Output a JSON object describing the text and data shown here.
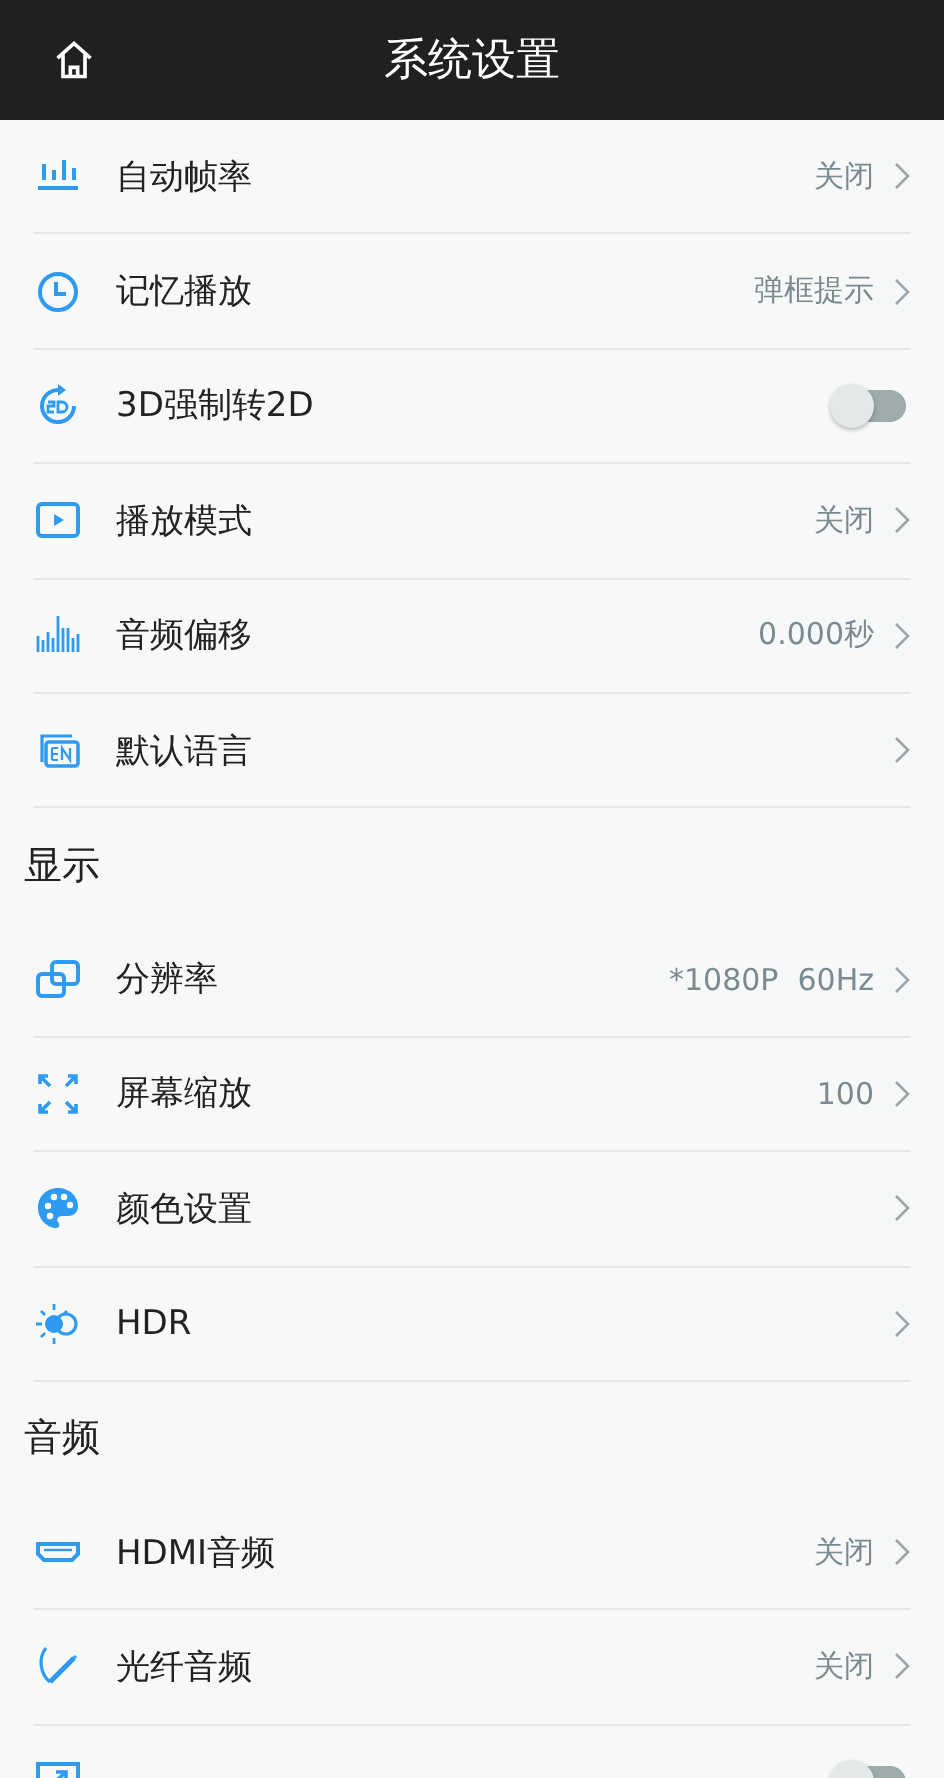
{
  "header": {
    "title": "系统设置"
  },
  "sections": [
    {
      "items": [
        {
          "kind": "value",
          "label": "自动帧率",
          "value": "关闭"
        },
        {
          "kind": "value",
          "label": "记忆播放",
          "value": "弹框提示"
        },
        {
          "kind": "switch",
          "label": "3D强制转2D",
          "on": false
        },
        {
          "kind": "value",
          "label": "播放模式",
          "value": "关闭"
        },
        {
          "kind": "value",
          "label": "音频偏移",
          "value": "0.000秒"
        },
        {
          "kind": "value",
          "label": "默认语言"
        }
      ]
    },
    {
      "title": "显示",
      "items": [
        {
          "kind": "value",
          "label": "分辨率",
          "value": "*1080P  60Hz"
        },
        {
          "kind": "value",
          "label": "屏幕缩放",
          "value": "100"
        },
        {
          "kind": "value",
          "label": "颜色设置"
        },
        {
          "kind": "value",
          "label": "HDR"
        }
      ]
    },
    {
      "title": "音频",
      "items": [
        {
          "kind": "value",
          "label": "HDMI音频",
          "value": "关闭"
        },
        {
          "kind": "value",
          "label": "光纤音频",
          "value": "关闭"
        },
        {
          "kind": "switch",
          "on": false
        }
      ]
    }
  ]
}
